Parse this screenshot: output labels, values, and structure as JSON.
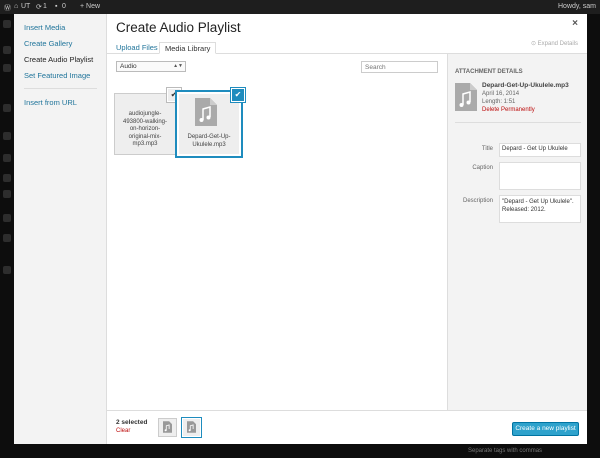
{
  "admin_bar": {
    "site_name": "UT",
    "updates": "1",
    "comments": "0",
    "new_label": "+ New",
    "howdy": "Howdy, sam"
  },
  "background_text": "Separate tags with commas",
  "menu": {
    "items": [
      {
        "label": "Insert Media",
        "active": false
      },
      {
        "label": "Create Gallery",
        "active": false
      },
      {
        "label": "Create Audio Playlist",
        "active": true
      },
      {
        "label": "Set Featured Image",
        "active": false
      },
      {
        "label": "Insert from URL",
        "active": false
      }
    ]
  },
  "frame": {
    "title": "Create Audio Playlist",
    "close": "×",
    "expand_details": "Expand Details"
  },
  "tabs": {
    "upload": "Upload Files",
    "library": "Media Library"
  },
  "toolbar": {
    "filter_value": "Audio",
    "filter_arrow": "▲▼",
    "search_placeholder": "Search"
  },
  "attachments": [
    {
      "name": "audiojungle-493800-walking-on-horizon-original-mix-mp3.mp3",
      "lines": [
        "audiojungle-",
        "493800-walking-",
        "on-horizon-",
        "original-mix-",
        "mp3.mp3"
      ],
      "selected": true,
      "details": false,
      "check": "✔"
    },
    {
      "name": "Depard-Get-Up-Ukulele.mp3",
      "lines": [
        "Depard-Get-Up-",
        "Ukulele.mp3"
      ],
      "selected": true,
      "details": true,
      "check": "✔"
    }
  ],
  "details": {
    "heading": "ATTACHMENT DETAILS",
    "filename": "Depard-Get-Up-Ukulele.mp3",
    "date": "April 16, 2014",
    "length": "Length: 1:51",
    "delete": "Delete Permanently",
    "title_label": "Title",
    "title_value": "Depard - Get Up Ukulele",
    "caption_label": "Caption",
    "caption_value": "",
    "description_label": "Description",
    "description_value": "\"Depard - Get Up Ukulele\". Released: 2012."
  },
  "footer": {
    "selected_count": "2 selected",
    "clear": "Clear",
    "create_button": "Create a new playlist"
  },
  "colors": {
    "accent": "#2ea2cc",
    "link": "#21759b",
    "delete": "#bc0b0b"
  }
}
